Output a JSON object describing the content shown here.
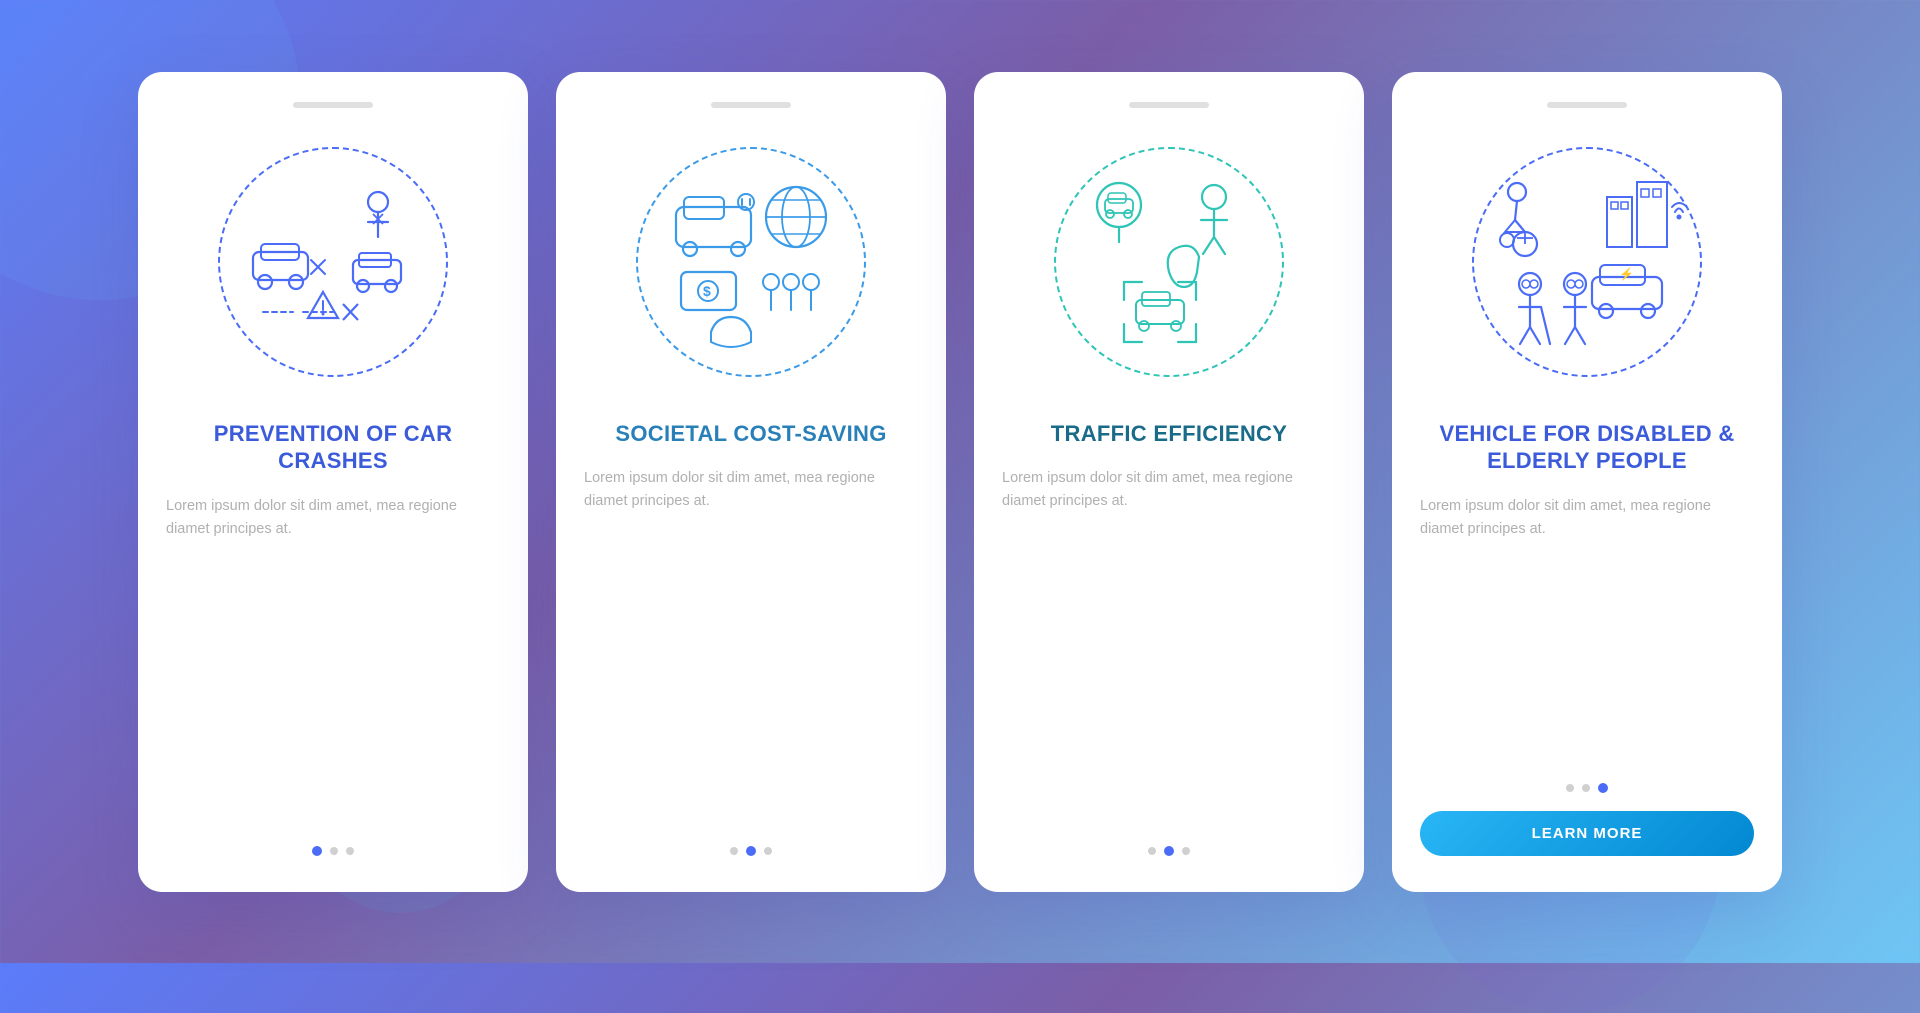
{
  "background": {
    "gradient_start": "#5b7cfa",
    "gradient_end": "#6ec6f5"
  },
  "cards": [
    {
      "id": "card-1",
      "notch": true,
      "title": "PREVENTION OF CAR CRASHES",
      "description": "Lorem ipsum dolor sit dim amet, mea regione diamet principes at.",
      "dots": [
        true,
        false,
        false
      ],
      "active_dot": 0,
      "has_button": false,
      "theme_color": "#3b5bdb",
      "dashed_color": "#4a6cf7"
    },
    {
      "id": "card-2",
      "notch": true,
      "title": "SOCIETAL COST-SAVING",
      "description": "Lorem ipsum dolor sit dim amet, mea regione diamet principes at.",
      "dots": [
        false,
        true,
        false
      ],
      "active_dot": 1,
      "has_button": false,
      "theme_color": "#2980b9",
      "dashed_color": "#3b9be8"
    },
    {
      "id": "card-3",
      "notch": true,
      "title": "TRAFFIC EFFICIENCY",
      "description": "Lorem ipsum dolor sit dim amet, mea regione diamet principes at.",
      "dots": [
        false,
        true,
        false
      ],
      "active_dot": 1,
      "has_button": false,
      "theme_color": "#1a6b8a",
      "dashed_color": "#2ec4b6"
    },
    {
      "id": "card-4",
      "notch": true,
      "title": "VEHICLE FOR DISABLED & ELDERLY PEOPLE",
      "description": "Lorem ipsum dolor sit dim amet, mea regione diamet principes at.",
      "dots": [
        false,
        false,
        true
      ],
      "active_dot": 2,
      "has_button": true,
      "button_label": "LEARN MORE",
      "theme_color": "#3b5bdb",
      "dashed_color": "#4a6cf7"
    }
  ]
}
